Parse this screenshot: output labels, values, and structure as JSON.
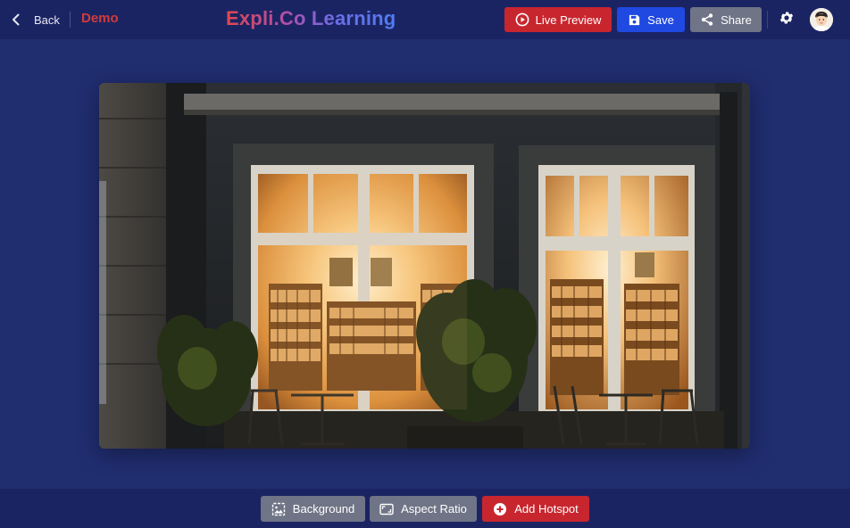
{
  "header": {
    "back_label": "Back",
    "project_name": "Demo",
    "app_title": "Expli.Co Learning",
    "live_preview_label": "Live Preview",
    "save_label": "Save",
    "share_label": "Share"
  },
  "toolbar": {
    "background_label": "Background",
    "aspect_ratio_label": "Aspect Ratio",
    "add_hotspot_label": "Add Hotspot"
  },
  "canvas": {
    "image_alt": "Bookshop storefront at night"
  },
  "colors": {
    "topbar": "#1b2463",
    "canvas": "#202d6f",
    "primary_red": "#c8262e",
    "primary_blue": "#1f49e0",
    "neutral_gray": "#6f7486"
  },
  "icons": {
    "back": "chevron-left-icon",
    "live_preview": "play-circle-icon",
    "save": "floppy-disk-icon",
    "share": "share-icon",
    "settings": "gear-icon",
    "background": "image-icon",
    "aspect_ratio": "aspect-ratio-icon",
    "add_hotspot": "plus-circle-icon"
  }
}
